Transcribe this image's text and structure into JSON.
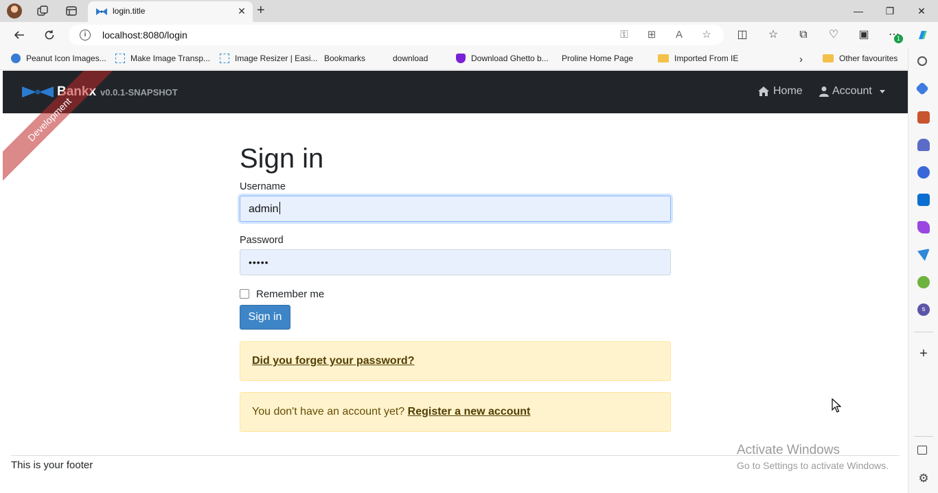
{
  "browser": {
    "tab_title": "login.title",
    "url": "localhost:8080/login",
    "bookmarks": [
      {
        "label": "Peanut Icon Images...",
        "icon": "peanut-icon"
      },
      {
        "label": "Make Image Transp...",
        "icon": "image-icon"
      },
      {
        "label": "Image Resizer | Easi...",
        "icon": "image-icon"
      },
      {
        "label": "Bookmarks",
        "icon": "page-icon"
      },
      {
        "label": "download",
        "icon": "page-icon"
      },
      {
        "label": "Download Ghetto b...",
        "icon": "shield-icon"
      },
      {
        "label": "Proline Home Page",
        "icon": "page-icon"
      },
      {
        "label": "Imported From IE",
        "icon": "folder-icon"
      }
    ],
    "other_favourites": "Other favourites",
    "extension_badge": "1"
  },
  "navbar": {
    "brand": "Bankx",
    "version": "v0.0.1-SNAPSHOT",
    "home": "Home",
    "account": "Account"
  },
  "ribbon": "Development",
  "login": {
    "title": "Sign in",
    "username_label": "Username",
    "username_value": "admin",
    "password_label": "Password",
    "password_value": "•••••",
    "remember_me": "Remember me",
    "remember_checked": false,
    "submit": "Sign in"
  },
  "alerts": {
    "forgot_password": "Did you forget your password?",
    "no_account_text": "You don't have an account yet?",
    "register": "Register a new account"
  },
  "footer": "This is your footer",
  "watermark": {
    "line1": "Activate Windows",
    "line2": "Go to Settings to activate Windows."
  },
  "colors": {
    "navbar_bg": "#212529",
    "primary_button": "#3d85c6",
    "alert_bg": "#fff3cd",
    "ribbon": "#be2828"
  }
}
